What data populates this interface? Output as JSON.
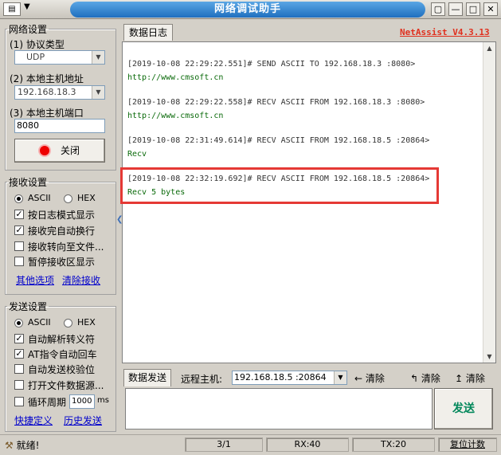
{
  "window": {
    "title": "网络调试助手"
  },
  "network": {
    "title": "网络设置",
    "protocol_label": "(1) 协议类型",
    "protocol_value": "UDP",
    "host_label": "(2) 本地主机地址",
    "host_value": "192.168.18.3",
    "port_label": "(3) 本地主机端口",
    "port_value": "8080",
    "close_label": "关闭"
  },
  "receive": {
    "title": "接收设置",
    "ascii": "ASCII",
    "hex": "HEX",
    "opt1": "按日志模式显示",
    "opt2": "接收完自动换行",
    "opt3": "接收转向至文件...",
    "opt4": "暂停接收区显示",
    "link_more": "其他选项",
    "link_clear": "清除接收"
  },
  "send": {
    "title": "发送设置",
    "ascii": "ASCII",
    "hex": "HEX",
    "opt1": "自动解析转义符",
    "opt2": "AT指令自动回车",
    "opt3": "自动发送校验位",
    "opt4": "打开文件数据源...",
    "opt5": "循环周期",
    "period_value": "1000",
    "period_unit": "ms",
    "link_shortcut": "快捷定义",
    "link_history": "历史发送"
  },
  "log": {
    "tab": "数据日志",
    "brand": "NetAssist V4.3.13",
    "lines": [
      {
        "header": "[2019-10-08 22:29:22.551]# SEND ASCII TO 192.168.18.3 :8080>",
        "body": "http://www.cmsoft.cn"
      },
      {
        "header": "[2019-10-08 22:29:22.558]# RECV ASCII FROM 192.168.18.3 :8080>",
        "body": "http://www.cmsoft.cn"
      },
      {
        "header": "[2019-10-08 22:31:49.614]# RECV ASCII FROM 192.168.18.5 :20864>",
        "body": "Recv"
      },
      {
        "header": "[2019-10-08 22:32:19.692]# RECV ASCII FROM 192.168.18.5 :20864>",
        "body": "Recv 5 bytes"
      }
    ]
  },
  "sendbar": {
    "tab": "数据发送",
    "remote_label": "远程主机:",
    "remote_value": "192.168.18.5 :20864",
    "clear1": "清除",
    "clear2": "清除",
    "clear3": "清除",
    "send_label": "发送"
  },
  "status": {
    "ready": "就绪!",
    "page": "3/1",
    "rx": "RX:40",
    "tx": "TX:20",
    "reset": "复位计数"
  }
}
